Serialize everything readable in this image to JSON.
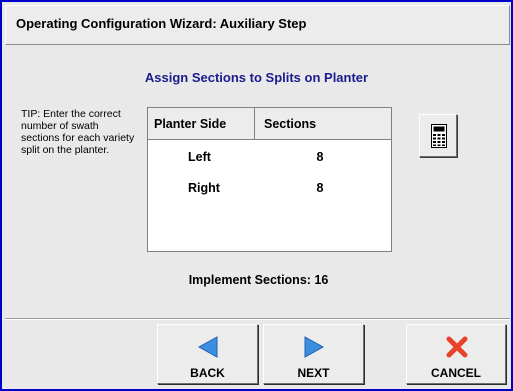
{
  "window": {
    "title": "Operating Configuration Wizard:  Auxiliary Step"
  },
  "main": {
    "heading": "Assign Sections to Splits on Planter",
    "tip": "TIP:  Enter the correct number of swath sections for each variety split on the planter.",
    "table": {
      "columns": [
        "Planter Side",
        "Sections"
      ],
      "rows": [
        {
          "side": "Left",
          "sections": "8"
        },
        {
          "side": "Right",
          "sections": "8"
        }
      ]
    },
    "calculator_icon": "calculator-icon",
    "implement_sections": "Implement Sections: 16"
  },
  "buttons": {
    "back": {
      "label": "BACK",
      "icon": "arrow-left-icon"
    },
    "next": {
      "label": "NEXT",
      "icon": "arrow-right-icon"
    },
    "cancel": {
      "label": "CANCEL",
      "icon": "x-icon"
    }
  },
  "colors": {
    "frame": "#0000cc",
    "heading": "#1b1b8f",
    "arrow": "#3a8fe0",
    "cancel_x": "#e8432a"
  }
}
